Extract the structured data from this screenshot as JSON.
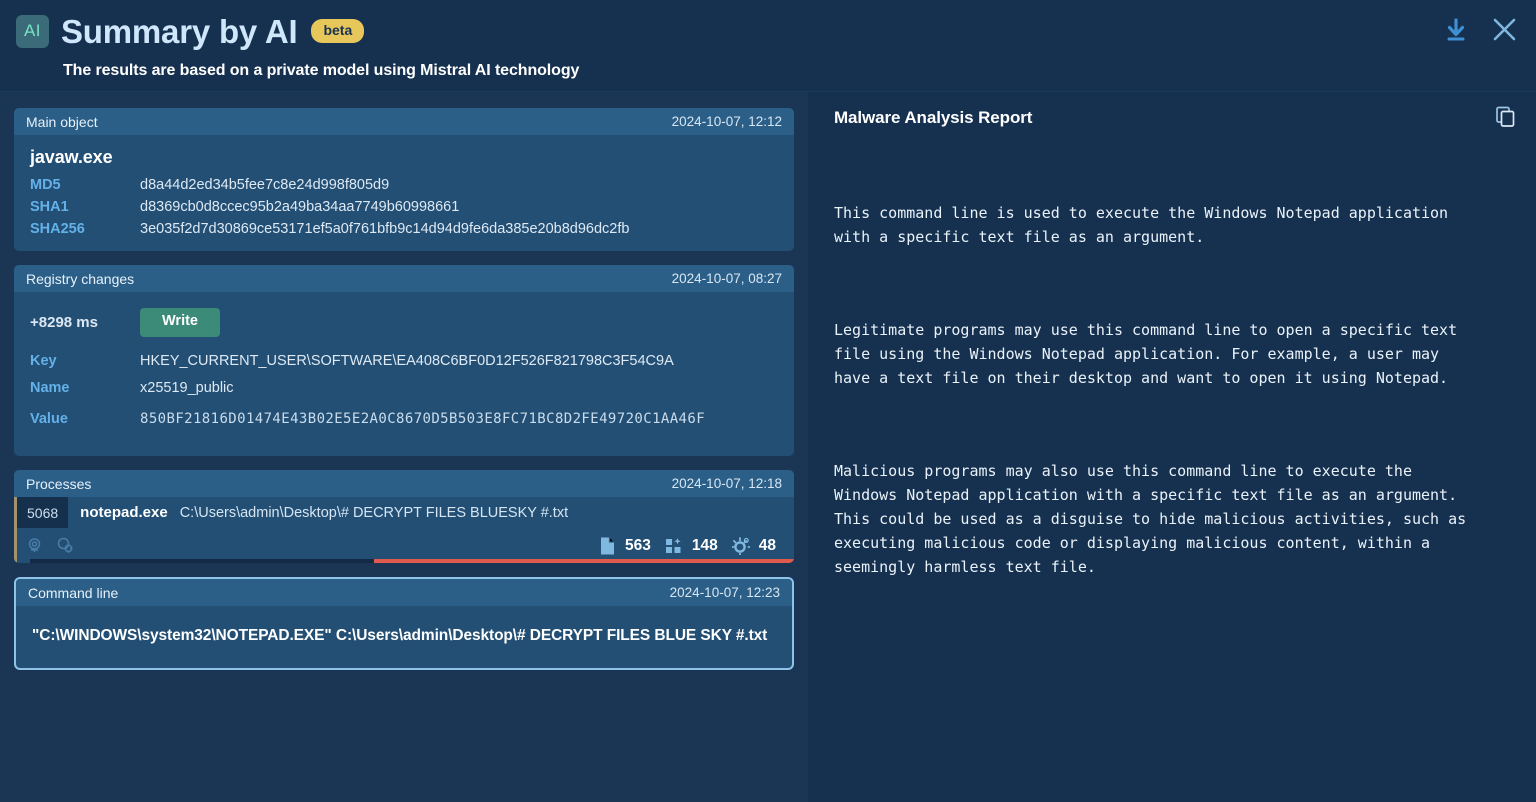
{
  "header": {
    "logo_text": "AI",
    "title": "Summary by AI",
    "beta_label": "beta",
    "subtitle": "The results are based on a private model using Mistral AI technology",
    "download_icon": "download-icon",
    "close_icon": "close-icon"
  },
  "cards": {
    "main_object": {
      "title": "Main object",
      "timestamp": "2024-10-07, 12:12",
      "name": "javaw.exe",
      "rows": [
        {
          "key": "MD5",
          "value": "d8a44d2ed34b5fee7c8e24d998f805d9"
        },
        {
          "key": "SHA1",
          "value": "d8369cb0d8ccec95b2a49ba34aa7749b60998661"
        },
        {
          "key": "SHA256",
          "value": "3e035f2d7d30869ce53171ef5a0f761bfb9c14d94d9fe6da385e20b8d96dc2fb"
        }
      ]
    },
    "registry_changes": {
      "title": "Registry changes",
      "timestamp": "2024-10-07, 08:27",
      "offset": "+8298 ms",
      "operation": "Write",
      "rows": [
        {
          "key": "Key",
          "value": "HKEY_CURRENT_USER\\SOFTWARE\\EA408C6BF0D12F526F821798C3F54C9A"
        },
        {
          "key": "Name",
          "value": "x25519_public"
        }
      ],
      "value_key": "Value",
      "value_text": "850BF21816D01474E43B02E5E2A0C8670D5B503E8FC71BC8D2FE49720C1AA46F"
    },
    "processes": {
      "title": "Processes",
      "timestamp": "2024-10-07, 12:18",
      "pid": "5068",
      "process_name": "notepad.exe",
      "arguments": "C:\\Users\\admin\\Desktop\\# DECRYPT FILES BLUESKY #.txt",
      "mini_icons": [
        "target-icon",
        "modules-gear-icon"
      ],
      "stats": [
        {
          "icon": "file-icon",
          "value": "563"
        },
        {
          "icon": "registry-icon",
          "value": "148"
        },
        {
          "icon": "gear-icon",
          "value": "48"
        }
      ]
    },
    "command_line": {
      "title": "Command line",
      "timestamp": "2024-10-07, 12:23",
      "text": "\"C:\\WINDOWS\\system32\\NOTEPAD.EXE\" C:\\Users\\admin\\Desktop\\# DECRYPT FILES BLUE SKY #.txt"
    }
  },
  "report": {
    "title": "Malware Analysis Report",
    "copy_icon": "copy-icon",
    "paragraphs": [
      "This command line is used to execute the Windows Notepad application with a specific text file as an argument.",
      "Legitimate programs may use this command line to open a specific text file using the Windows Notepad application. For example, a user may have a text file on their desktop and want to open it using Notepad.",
      "Malicious programs may also use this command line to execute the Windows Notepad application with a specific text file as an argument. This could be used as a disguise to hide malicious activities, such as executing malicious code or displaying malicious content, within a seemingly harmless text file."
    ]
  },
  "colors": {
    "page_bg": "#16314f",
    "left_pane_bg": "#1a3654",
    "card_bg": "#234f74",
    "card_head_bg": "#2c5f87",
    "accent_blue": "#63b1e8",
    "title_blue": "#cfe6fb",
    "beta_yellow": "#e8c75a",
    "write_green": "#3c8a78",
    "bar_red": "#e05b4e",
    "selected_border": "#8fc3ea",
    "proc_accent": "#a3926a"
  }
}
